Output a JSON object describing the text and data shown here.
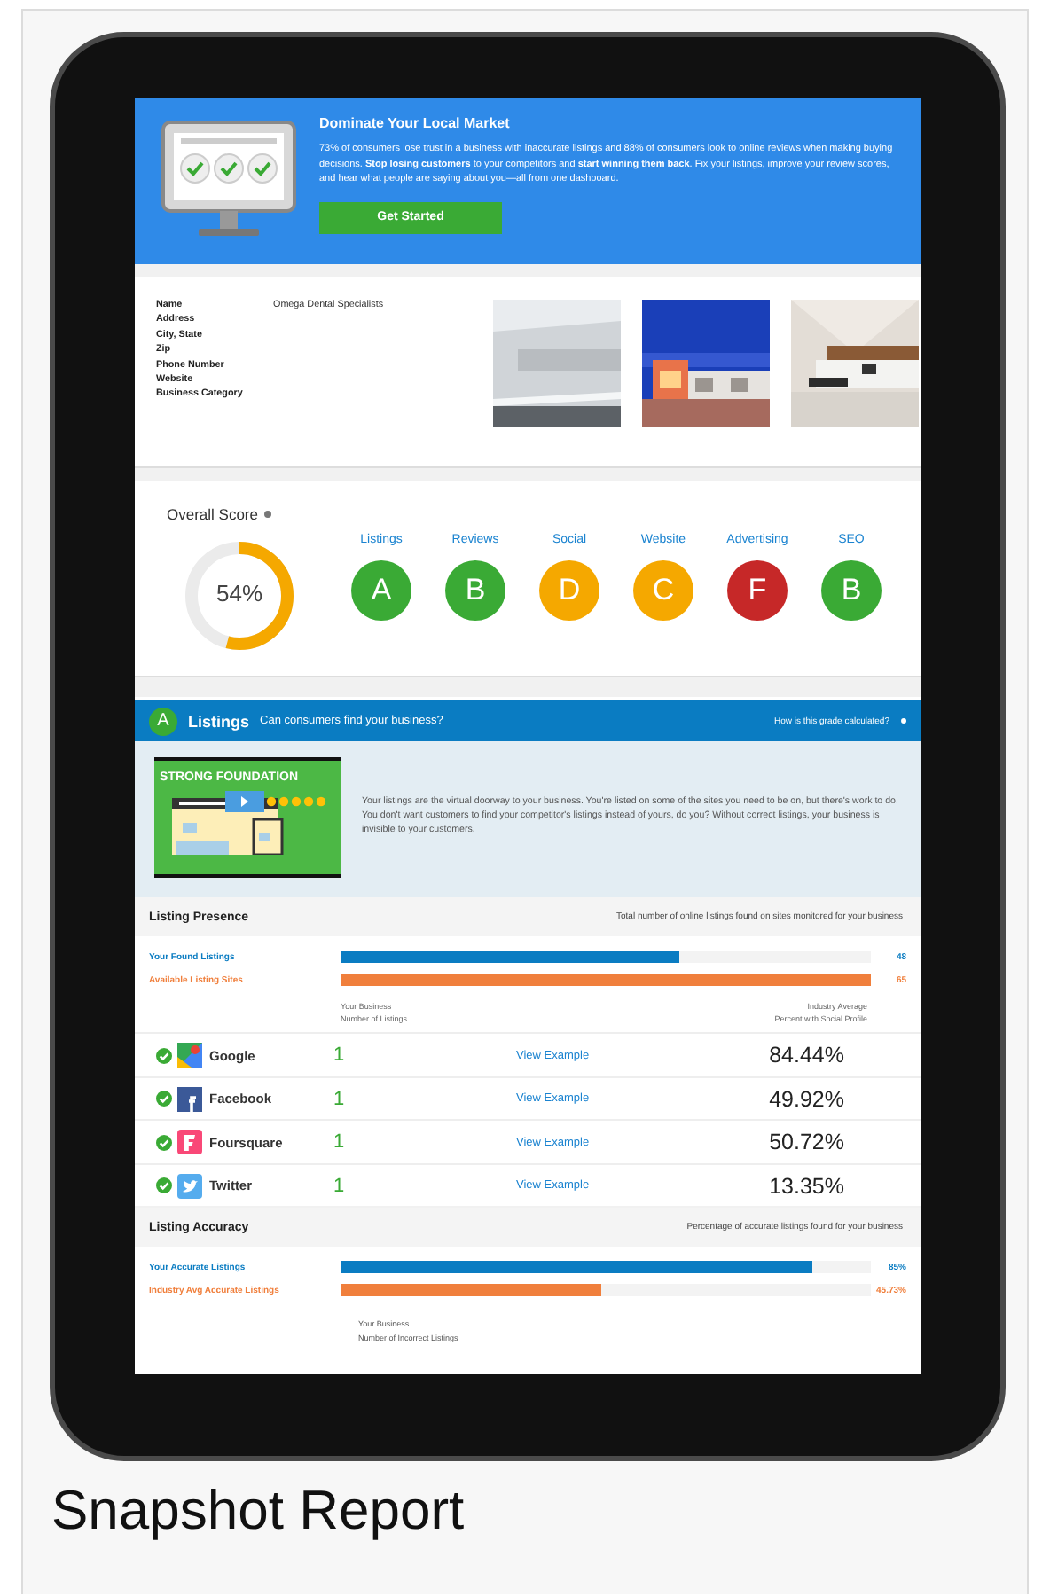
{
  "hero": {
    "title": "Dominate Your Local Market",
    "text": "73% of consumers lose trust in a business with inaccurate listings and 88% of consumers look to online reviews when making buying decisions. **Stop losing customers** to your competitors and **start winning them back**. Fix your listings, improve your review scores, and hear what people are saying about you—all from one dashboard.",
    "button": "Get Started"
  },
  "business": {
    "fields": [
      {
        "label": "Name",
        "value": "Omega Dental Specialists"
      },
      {
        "label": "Address"
      },
      {
        "label": "City, State"
      },
      {
        "label": "Zip"
      },
      {
        "label": "Phone Number"
      },
      {
        "label": "Website"
      },
      {
        "label": "Business Category"
      }
    ]
  },
  "score": {
    "title": "Overall Score",
    "value": "54%",
    "level": 0.54,
    "grades": [
      {
        "label": "Listings",
        "grade": "A",
        "color": "#3aaa35"
      },
      {
        "label": "Reviews",
        "grade": "B",
        "color": "#3aaa35"
      },
      {
        "label": "Social",
        "grade": "D",
        "color": "#f5a800"
      },
      {
        "label": "Website",
        "grade": "C",
        "color": "#f5a800"
      },
      {
        "label": "Advertising",
        "grade": "F",
        "color": "#c62828"
      },
      {
        "label": "SEO",
        "grade": "B",
        "color": "#3aaa35"
      }
    ]
  },
  "listings": {
    "grade": "A",
    "title": "Listings",
    "question": "Can consumers find your business?",
    "help_link": "How is this grade calculated?",
    "banner": "STRONG FOUNDATION",
    "description": "Your listings are the virtual doorway to your business. You're listed on some of the sites you need to be on, but there's work to do. You don't want customers to find your competitor's listings instead of yours, do you? Without correct listings, your business is invisible to your customers."
  },
  "presence": {
    "title": "Listing Presence",
    "subtitle": "Total number of online listings found on sites monitored for your business",
    "bars": [
      {
        "label": "Your Found Listings",
        "value": "48",
        "level": 0.64,
        "color": "#0a7cc2"
      },
      {
        "label": "Available Listing Sites",
        "value": "65",
        "level": 1.0,
        "color": "#f07f3c"
      }
    ],
    "column_headers": [
      [
        "Your Business",
        "Number of Listings"
      ],
      [
        "Industry Average",
        "Percent with Social Profile"
      ]
    ],
    "rows": [
      {
        "kind": "google",
        "verified": true,
        "site": "Google",
        "count": "1",
        "link": "View Example",
        "percent": "84.44%"
      },
      {
        "kind": "facebook",
        "verified": true,
        "site": "Facebook",
        "count": "1",
        "link": "View Example",
        "percent": "49.92%"
      },
      {
        "kind": "foursquare",
        "verified": true,
        "site": "Foursquare",
        "count": "1",
        "link": "View Example",
        "percent": "50.72%"
      },
      {
        "kind": "twitter",
        "verified": true,
        "site": "Twitter",
        "count": "1",
        "link": "View Example",
        "percent": "13.35%"
      }
    ]
  },
  "accuracy": {
    "title": "Listing Accuracy",
    "subtitle": "Percentage of accurate listings found for your business",
    "bars": [
      {
        "label": "Your Accurate Listings",
        "value": "85%",
        "level": 0.89,
        "color": "#0a7cc2"
      },
      {
        "label": "Industry Avg Accurate Listings",
        "value": "45.73%",
        "level": 0.49,
        "color": "#f07f3c"
      }
    ],
    "footer_header": [
      "Your Business",
      "Number of Incorrect Listings"
    ]
  },
  "caption": "Snapshot Report"
}
